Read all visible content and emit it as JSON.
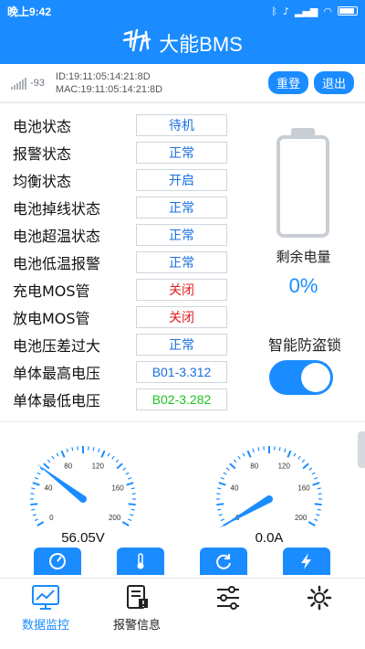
{
  "status_bar": {
    "time": "晚上9:42",
    "icons": [
      "bluetooth-icon",
      "mute-icon",
      "signal-icon",
      "wifi-icon",
      "battery-icon"
    ]
  },
  "header": {
    "logo_text": "大能",
    "title": "大能BMS"
  },
  "device": {
    "rssi": "-93",
    "id_line": "ID:19:11:05:14:21:8D",
    "mac_line": "MAC:19:11:05:14:21:8D",
    "reset_label": "重登",
    "exit_label": "退出"
  },
  "status_rows": [
    {
      "label": "电池状态",
      "value": "待机",
      "color": "#1a6fe0"
    },
    {
      "label": "报警状态",
      "value": "正常",
      "color": "#1a6fe0"
    },
    {
      "label": "均衡状态",
      "value": "开启",
      "color": "#1a6fe0"
    },
    {
      "label": "电池掉线状态",
      "value": "正常",
      "color": "#1a6fe0"
    },
    {
      "label": "电池超温状态",
      "value": "正常",
      "color": "#1a6fe0"
    },
    {
      "label": "电池低温报警",
      "value": "正常",
      "color": "#1a6fe0"
    },
    {
      "label": "充电MOS管",
      "value": "关闭",
      "color": "#e02020"
    },
    {
      "label": "放电MOS管",
      "value": "关闭",
      "color": "#e02020"
    },
    {
      "label": "电池压差过大",
      "value": "正常",
      "color": "#1a6fe0"
    },
    {
      "label": "单体最高电压",
      "value": "B01-3.312",
      "color": "#1a6fe0"
    },
    {
      "label": "单体最低电压",
      "value": "B02-3.282",
      "color": "#1ec21e"
    }
  ],
  "battery": {
    "remain_label": "剩余电量",
    "remain_value": "0%",
    "remain_fraction": 0
  },
  "anti_theft": {
    "label": "智能防盗锁",
    "enabled": true
  },
  "gauges": [
    {
      "name": "voltage",
      "ticks": [
        "0",
        "40",
        "80",
        "120",
        "160",
        "200"
      ],
      "value": 56.05,
      "display": "56.05V"
    },
    {
      "name": "current",
      "ticks": [
        "0",
        "40",
        "80",
        "120",
        "160",
        "200"
      ],
      "value": 0,
      "display": "0.0A"
    }
  ],
  "shortcuts": [
    "speed-icon",
    "thermometer-icon",
    "refresh-icon",
    "lightning-icon"
  ],
  "tabs": [
    {
      "label": "数据监控",
      "icon": "chart-monitor-icon",
      "active": true
    },
    {
      "label": "报警信息",
      "icon": "alarm-document-icon",
      "active": false
    },
    {
      "label": "",
      "icon": "sliders-icon",
      "active": false
    },
    {
      "label": "",
      "icon": "settings-gear-icon",
      "active": false
    }
  ],
  "colors": {
    "primary": "#1a8cff",
    "red": "#e02020",
    "green": "#1ec21e"
  }
}
